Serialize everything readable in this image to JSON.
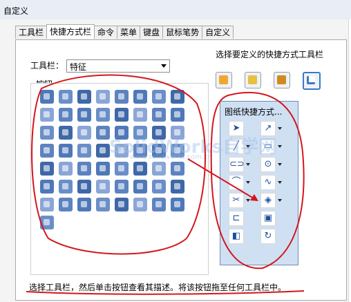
{
  "window": {
    "title": "自定义"
  },
  "tabs": [
    {
      "label": "工具栏",
      "active": false
    },
    {
      "label": "快捷方式栏",
      "active": true
    },
    {
      "label": "命令",
      "active": false
    },
    {
      "label": "菜单",
      "active": false
    },
    {
      "label": "键盘",
      "active": false
    },
    {
      "label": "鼠标笔势",
      "active": false
    },
    {
      "label": "自定义",
      "active": false
    }
  ],
  "toolbar_field": {
    "label": "工具栏：",
    "value": "特征"
  },
  "buttons_group": {
    "label": "按钮"
  },
  "shortcut_bar_picker": {
    "label": "选择要定义的快捷方式工具栏",
    "options": [
      {
        "icon": "part-shortcut-icon",
        "color": "#f0a830"
      },
      {
        "icon": "assembly-shortcut-icon",
        "color": "#e8c040"
      },
      {
        "icon": "drawing-shortcut-icon",
        "color": "#d08a20"
      },
      {
        "icon": "sketch-shortcut-icon",
        "color": "#3a78c8"
      }
    ]
  },
  "feature_buttons": {
    "icon_names": [
      "boss-extrude-icon",
      "revolve-icon",
      "sweep-icon",
      "loft-icon",
      "cut-extrude-icon",
      "cut-revolve-icon",
      "cut-sweep-icon",
      "cut-loft-icon",
      "fillet-icon",
      "chamfer-icon",
      "rib-icon",
      "shell-icon",
      "draft-icon",
      "hole-icon",
      "wrap-icon",
      "dome-icon",
      "linear-pattern-icon",
      "circular-pattern-icon",
      "mirror-icon",
      "curve-pattern-icon",
      "sketch-pattern-icon",
      "table-pattern-icon",
      "fill-pattern-icon",
      "scale-icon",
      "split-icon",
      "combine-icon",
      "move-face-icon",
      "delete-face-icon",
      "replace-face-icon",
      "intersect-icon",
      "thicken-icon",
      "indent-icon",
      "reference-plane-icon",
      "measure-icon",
      "axis-icon",
      "coordinate-system-icon",
      "point-icon",
      "mate-reference-icon",
      "bounding-box-icon",
      "center-of-mass-icon",
      "split-line-icon",
      "projected-curve-icon",
      "composite-curve-icon",
      "helix-icon",
      "curve-through-points-icon",
      "curve-xyz-icon",
      "instant3d-icon",
      "freeform-icon",
      "deform-icon",
      "flex-icon",
      "cavity-icon",
      "mold-icon",
      "imported-geometry-icon",
      "feature-works-icon",
      "wizard-hole-icon",
      "check-icon",
      "rebuild-3d-icon"
    ],
    "colors": [
      "#4f78b8",
      "#6a8fc8",
      "#3f68a8",
      "#8aa6d6",
      "#5d82c0"
    ]
  },
  "drawing_toolbar": {
    "title": "图纸快捷方式...",
    "items": [
      {
        "icon": "select-arrow-icon",
        "dropdown": false,
        "symbol": "➤"
      },
      {
        "icon": "smart-dimension-icon",
        "dropdown": true,
        "symbol": "↗"
      },
      {
        "icon": "line-icon",
        "dropdown": true,
        "symbol": "╱"
      },
      {
        "icon": "rectangle-icon",
        "dropdown": true,
        "symbol": "▭"
      },
      {
        "icon": "slot-icon",
        "dropdown": true,
        "symbol": "⊂⊃"
      },
      {
        "icon": "circle-icon",
        "dropdown": true,
        "symbol": "⊙"
      },
      {
        "icon": "arc-icon",
        "dropdown": true,
        "symbol": "⌒"
      },
      {
        "icon": "spline-icon",
        "dropdown": true,
        "symbol": "∿"
      },
      {
        "icon": "trim-icon",
        "dropdown": true,
        "symbol": "✂"
      },
      {
        "icon": "cube-view-icon",
        "dropdown": true,
        "symbol": "◈"
      },
      {
        "icon": "offset-icon",
        "dropdown": false,
        "symbol": "⊏"
      },
      {
        "icon": "model-view-icon",
        "dropdown": false,
        "symbol": "▣"
      },
      {
        "icon": "standard-views-icon",
        "dropdown": false,
        "symbol": "◧"
      },
      {
        "icon": "rotate-view-icon",
        "dropdown": false,
        "symbol": "↻"
      }
    ]
  },
  "status_text": "选择工具栏，然后单击按钮查看其描述。将该按钮拖至任何工具栏中。",
  "watermark": {
    "text": "SolidWorks自学网",
    "url": "www.solidworks.com.cn"
  },
  "annotation_color": "#d4161c"
}
